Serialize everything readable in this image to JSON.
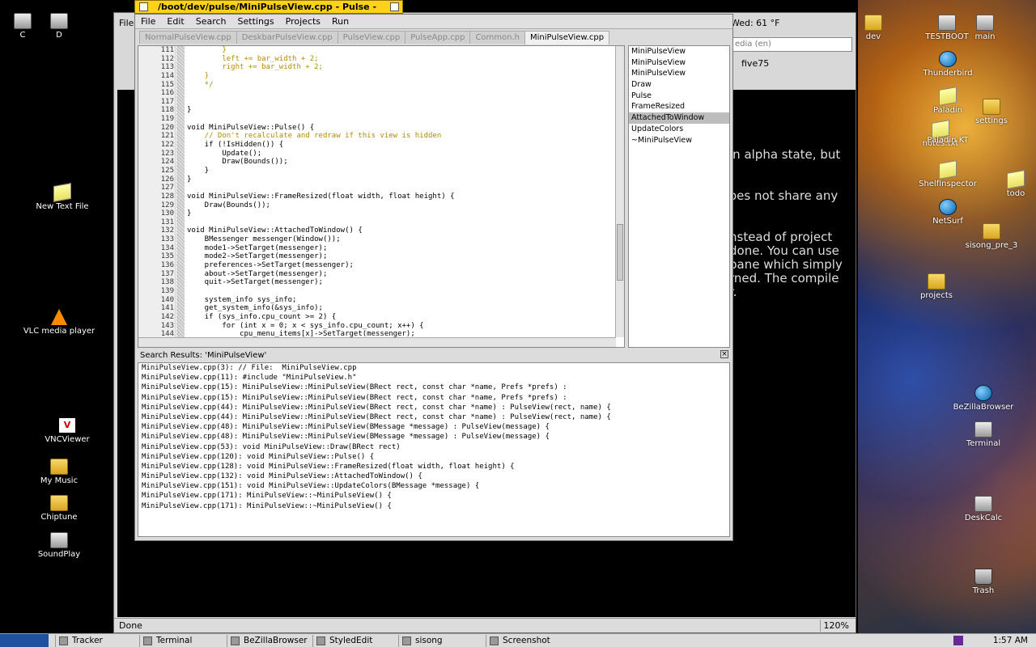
{
  "desktop": {
    "left_icons": [
      {
        "label": "C",
        "icon": "drive-icon"
      },
      {
        "label": "D",
        "icon": "drive-icon"
      },
      {
        "label": "New Text File",
        "icon": "text-file-icon"
      },
      {
        "label": "VLC media player",
        "icon": "vlc-icon"
      },
      {
        "label": "VNCViewer",
        "icon": "vnc-icon"
      },
      {
        "label": "My Music",
        "icon": "folder-icon"
      },
      {
        "label": "Chiptune",
        "icon": "folder-icon"
      },
      {
        "label": "SoundPlay",
        "icon": "soundplay-icon"
      }
    ],
    "right_icons": [
      {
        "label": "dev",
        "icon": "folder-icon"
      },
      {
        "label": "TESTBOOT",
        "icon": "drive-icon"
      },
      {
        "label": "main",
        "icon": "drive-icon"
      },
      {
        "label": "Thunderbird",
        "icon": "thunderbird-icon"
      },
      {
        "label": "Paladin",
        "icon": "paladin-icon"
      },
      {
        "label": "settings",
        "icon": "folder-icon"
      },
      {
        "label": "notes.txt",
        "icon": "text-file-icon"
      },
      {
        "label": "Paladin KT",
        "icon": "paladin-icon"
      },
      {
        "label": "ShelfInspector",
        "icon": "shelf-icon"
      },
      {
        "label": "todo",
        "icon": "text-file-icon"
      },
      {
        "label": "NetSurf",
        "icon": "netsurf-icon"
      },
      {
        "label": "sisong_pre_3",
        "icon": "folder-icon"
      },
      {
        "label": "projects",
        "icon": "folder-icon"
      },
      {
        "label": "BeZillaBrowser",
        "icon": "bezilla-icon"
      },
      {
        "label": "Terminal",
        "icon": "terminal-icon"
      },
      {
        "label": "DeskCalc",
        "icon": "calc-icon"
      },
      {
        "label": "Trash",
        "icon": "trash-icon"
      }
    ]
  },
  "background_window": {
    "menu_file": "File",
    "weather": "Wed: 61 °F",
    "search_placeholder": "edia (en)",
    "bookmark": "five75",
    "status": "Done",
    "zoom": "120%",
    "page_text": [
      "in alpha state, but",
      "oes not share any",
      "nstead of project",
      "done. You can use",
      "pane which simply",
      "rned. The compile",
      "r."
    ]
  },
  "editor_window": {
    "title": "/boot/dev/pulse/MiniPulseView.cpp - Pulse - Sisong",
    "menu": [
      "File",
      "Edit",
      "Search",
      "Settings",
      "Projects",
      "Run"
    ],
    "tabs": [
      "NormalPulseView.cpp",
      "DeskbarPulseView.cpp",
      "PulseView.cpp",
      "PulseApp.cpp",
      "Common.h",
      "MiniPulseView.cpp"
    ],
    "active_tab": 5,
    "code_lines": [
      {
        "n": "111",
        "t": "        }",
        "c": true
      },
      {
        "n": "112",
        "t": "        left += bar_width + 2;",
        "c": true
      },
      {
        "n": "113",
        "t": "        right += bar_width + 2;",
        "c": true
      },
      {
        "n": "114",
        "t": "    }",
        "c": true
      },
      {
        "n": "115",
        "t": "    */",
        "c": true
      },
      {
        "n": "116",
        "t": "",
        "c": false
      },
      {
        "n": "117",
        "t": "",
        "c": false
      },
      {
        "n": "118",
        "t": "}",
        "c": false
      },
      {
        "n": "119",
        "t": "",
        "c": false
      },
      {
        "n": "120",
        "t": "void MiniPulseView::Pulse() {",
        "c": false
      },
      {
        "n": "121",
        "t": "    // Don't recalculate and redraw if this view is hidden",
        "c": true
      },
      {
        "n": "122",
        "t": "    if (!IsHidden()) {",
        "c": false
      },
      {
        "n": "123",
        "t": "        Update();",
        "c": false
      },
      {
        "n": "124",
        "t": "        Draw(Bounds());",
        "c": false
      },
      {
        "n": "125",
        "t": "    }",
        "c": false
      },
      {
        "n": "126",
        "t": "}",
        "c": false
      },
      {
        "n": "127",
        "t": "",
        "c": false
      },
      {
        "n": "128",
        "t": "void MiniPulseView::FrameResized(float width, float height) {",
        "c": false
      },
      {
        "n": "129",
        "t": "    Draw(Bounds());",
        "c": false
      },
      {
        "n": "130",
        "t": "}",
        "c": false
      },
      {
        "n": "131",
        "t": "",
        "c": false
      },
      {
        "n": "132",
        "t": "void MiniPulseView::AttachedToWindow() {",
        "c": false
      },
      {
        "n": "133",
        "t": "    BMessenger messenger(Window());",
        "c": false
      },
      {
        "n": "134",
        "t": "    mode1->SetTarget(messenger);",
        "c": false
      },
      {
        "n": "135",
        "t": "    mode2->SetTarget(messenger);",
        "c": false
      },
      {
        "n": "136",
        "t": "    preferences->SetTarget(messenger);",
        "c": false
      },
      {
        "n": "137",
        "t": "    about->SetTarget(messenger);",
        "c": false
      },
      {
        "n": "138",
        "t": "    quit->SetTarget(messenger);",
        "c": false
      },
      {
        "n": "139",
        "t": "",
        "c": false
      },
      {
        "n": "140",
        "t": "    system_info sys_info;",
        "c": false
      },
      {
        "n": "141",
        "t": "    get_system_info(&sys_info);",
        "c": false
      },
      {
        "n": "142",
        "t": "    if (sys_info.cpu_count >= 2) {",
        "c": false
      },
      {
        "n": "143",
        "t": "        for (int x = 0; x < sys_info.cpu_count; x++) {",
        "c": false
      },
      {
        "n": "144",
        "t": "            cpu_menu_items[x]->SetTarget(messenger);",
        "c": false
      }
    ],
    "symbols": [
      "MiniPulseView",
      "MiniPulseView",
      "MiniPulseView",
      "Draw",
      "Pulse",
      "FrameResized",
      "AttachedToWindow",
      "UpdateColors",
      "~MiniPulseView"
    ],
    "selected_symbol": 6,
    "results_title": "Search Results: 'MiniPulseView'",
    "results": [
      "MiniPulseView.cpp(3): // File:  MiniPulseView.cpp",
      "MiniPulseView.cpp(11): #include \"MiniPulseView.h\"",
      "MiniPulseView.cpp(15): MiniPulseView::MiniPulseView(BRect rect, const char *name, Prefs *prefs) :",
      "MiniPulseView.cpp(15): MiniPulseView::MiniPulseView(BRect rect, const char *name, Prefs *prefs) :",
      "MiniPulseView.cpp(44): MiniPulseView::MiniPulseView(BRect rect, const char *name) : PulseView(rect, name) {",
      "MiniPulseView.cpp(44): MiniPulseView::MiniPulseView(BRect rect, const char *name) : PulseView(rect, name) {",
      "MiniPulseView.cpp(48): MiniPulseView::MiniPulseView(BMessage *message) : PulseView(message) {",
      "MiniPulseView.cpp(48): MiniPulseView::MiniPulseView(BMessage *message) : PulseView(message) {",
      "MiniPulseView.cpp(53): void MiniPulseView::Draw(BRect rect)",
      "MiniPulseView.cpp(120): void MiniPulseView::Pulse() {",
      "MiniPulseView.cpp(128): void MiniPulseView::FrameResized(float width, float height) {",
      "MiniPulseView.cpp(132): void MiniPulseView::AttachedToWindow() {",
      "MiniPulseView.cpp(151): void MiniPulseView::UpdateColors(BMessage *message) {",
      "MiniPulseView.cpp(171): MiniPulseView::~MiniPulseView() {",
      "MiniPulseView.cpp(171): MiniPulseView::~MiniPulseView() {"
    ]
  },
  "taskbar": {
    "tasks": [
      "Tracker",
      "Terminal",
      "BeZillaBrowser",
      "StyledEdit",
      "sisong",
      "Screenshot"
    ],
    "clock": "1:57 AM"
  }
}
